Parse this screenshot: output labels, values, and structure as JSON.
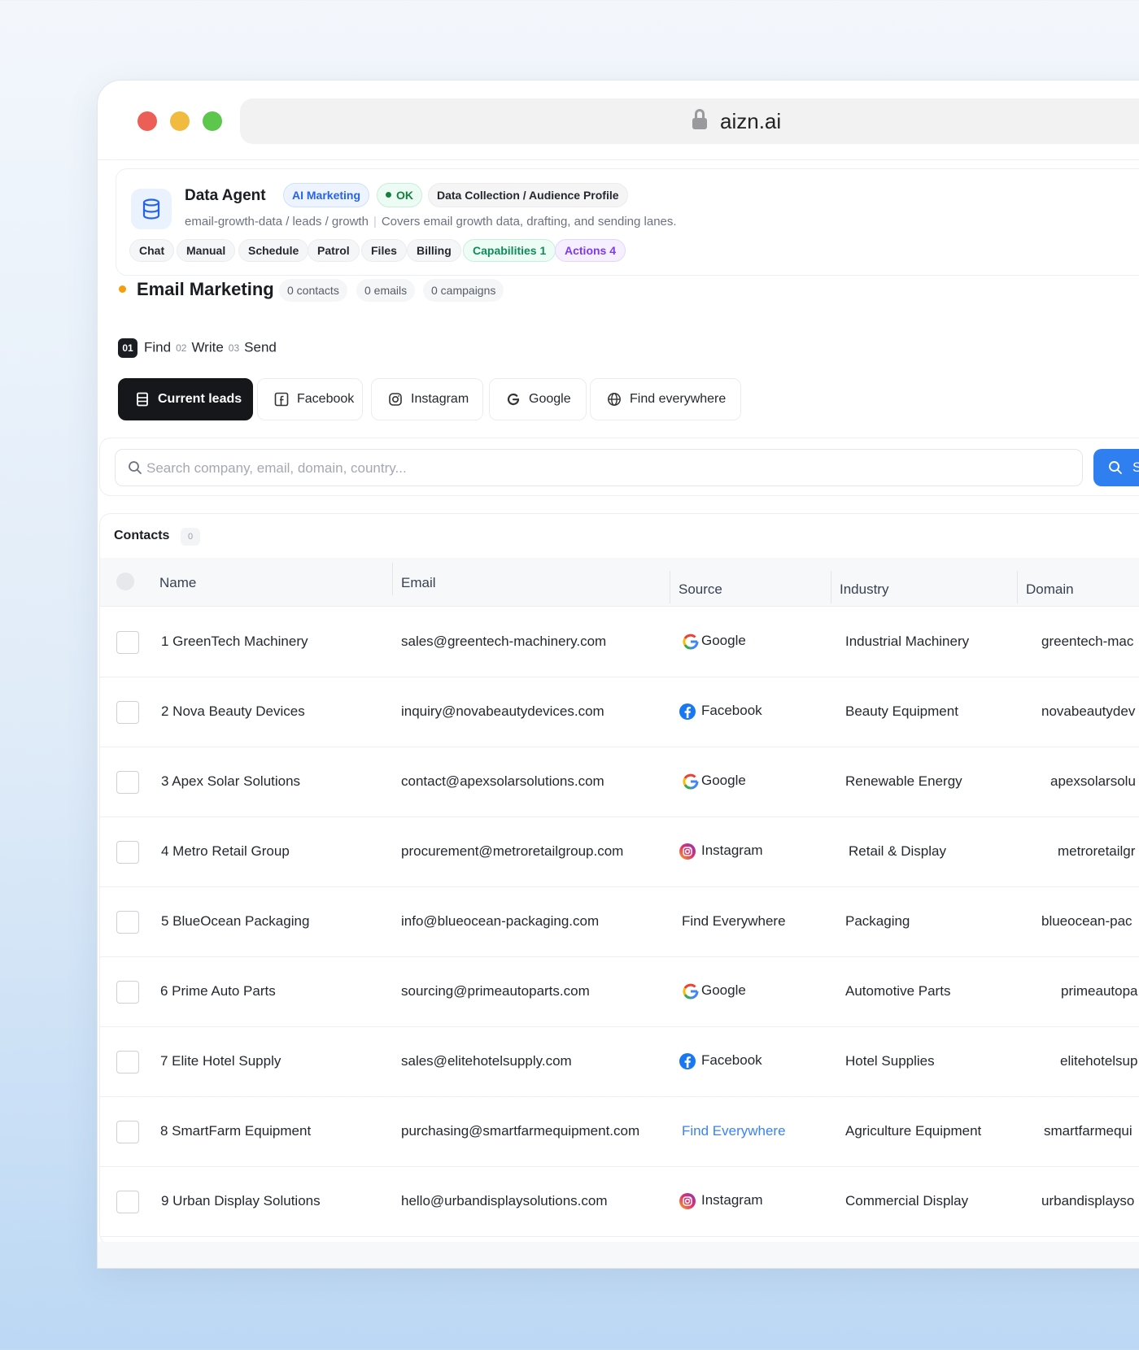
{
  "browser": {
    "url": "aizn.ai"
  },
  "agent": {
    "title": "Data Agent",
    "tag_ai": "AI Marketing",
    "tag_ok": "OK",
    "tag_profile": "Data Collection / Audience Profile",
    "path": "email-growth-data / leads / growth",
    "description": "Covers email growth data, drafting, and sending lanes.",
    "chips": [
      "Chat",
      "Manual",
      "Schedule",
      "Patrol",
      "Files",
      "Billing",
      "Capabilities 1",
      "Actions 4"
    ]
  },
  "email_marketing": {
    "title": "Email Marketing",
    "stats": [
      "0 contacts",
      "0 emails",
      "0 campaigns"
    ]
  },
  "steps": {
    "step1_num": "01",
    "step1_label": "Find",
    "step2_num": "02",
    "step2_label": "Write",
    "step3_num": "03",
    "step3_label": "Send"
  },
  "sources": {
    "current_leads": "Current leads",
    "facebook": "Facebook",
    "instagram": "Instagram",
    "google": "Google",
    "find_everywhere": "Find everywhere"
  },
  "search": {
    "placeholder": "Search company, email, domain, country...",
    "button_label": "S"
  },
  "contacts": {
    "title": "Contacts",
    "count": "0",
    "columns": {
      "name": "Name",
      "email": "Email",
      "source": "Source",
      "industry": "Industry",
      "domain": "Domain"
    },
    "rows": [
      {
        "name": "1  GreenTech Machinery",
        "email": "sales@greentech-machinery.com",
        "source": "Google",
        "industry": "Industrial Machinery",
        "domain": "greentech-mac"
      },
      {
        "name": "2  Nova Beauty Devices",
        "email": "inquiry@novabeautydevices.com",
        "source": "Facebook",
        "industry": "Beauty Equipment",
        "domain": "novabeautydev"
      },
      {
        "name": "3 Apex Solar Solutions",
        "email": "contact@apexsolarsolutions.com",
        "source": "Google",
        "industry": "Renewable Energy",
        "domain": "apexsolarsolu"
      },
      {
        "name": "4  Metro Retail Group",
        "email": "procurement@metroretailgroup.com",
        "source": "Instagram",
        "industry": "Retail & Display",
        "domain": "metroretailgr"
      },
      {
        "name": "5  BlueOcean Packaging",
        "email": "info@blueocean-packaging.com",
        "source": "Find Everywhere",
        "industry": "Packaging",
        "domain": "blueocean-pac"
      },
      {
        "name": "6  Prime Auto Parts",
        "email": "sourcing@primeautoparts.com",
        "source": "Google",
        "industry": "Automotive Parts",
        "domain": "primeautopa"
      },
      {
        "name": "7  Elite Hotel Supply",
        "email": "sales@elitehotelsupply.com",
        "source": "Facebook",
        "industry": "Hotel Supplies",
        "domain": "elitehotelsup"
      },
      {
        "name": "8  SmartFarm Equipment",
        "email": "purchasing@smartfarmequipment.com",
        "source": "Find Everywhere",
        "industry": "Agriculture Equipment",
        "domain": "smartfarmequi"
      },
      {
        "name": "9  Urban Display Solutions",
        "email": "hello@urbandisplaysolutions.com",
        "source": "Instagram",
        "industry": "Commercial Display",
        "domain": "urbandisplayso"
      }
    ]
  },
  "colors": {
    "accent_blue": "#2f7ff0",
    "ok_green": "#15803d",
    "status_orange": "#f59e0b",
    "dark_button": "#15171a"
  }
}
